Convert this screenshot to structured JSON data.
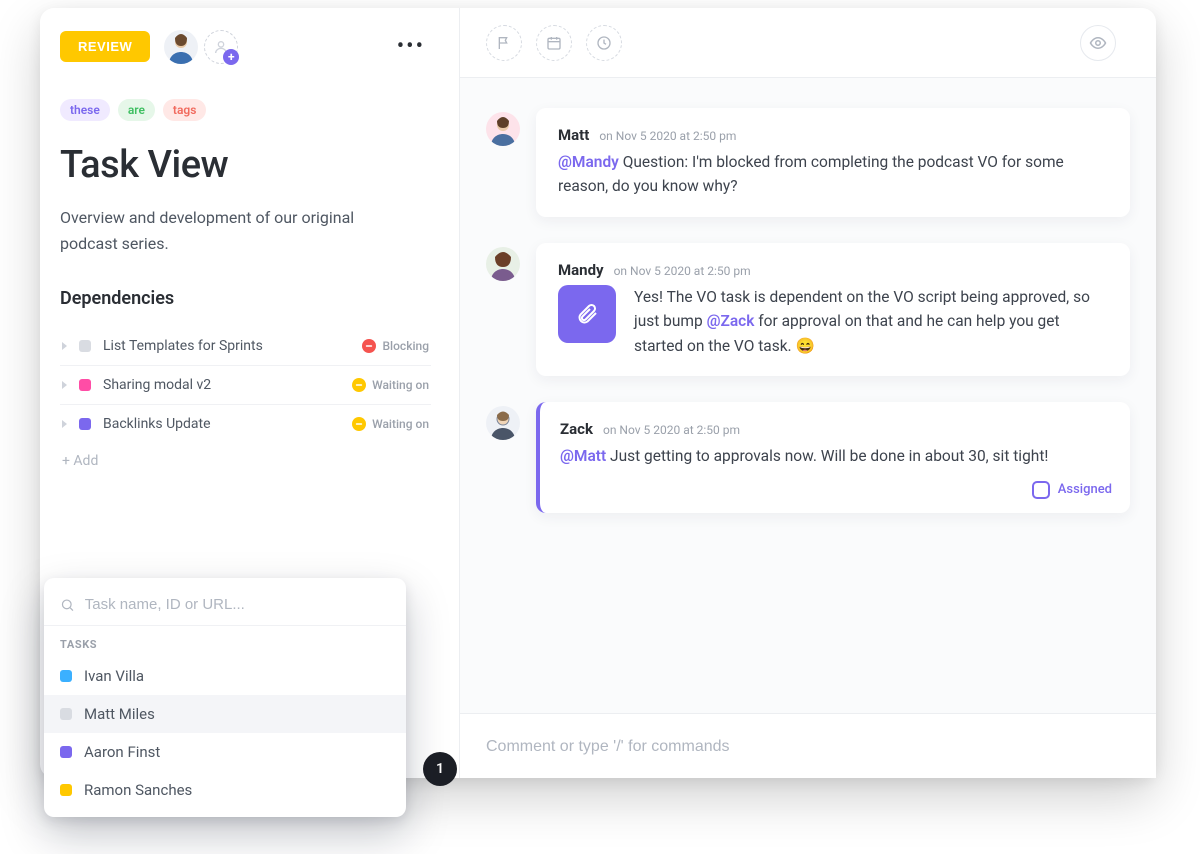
{
  "header": {
    "review_label": "REVIEW"
  },
  "tags": [
    {
      "label": "these",
      "cls": "tag-purple"
    },
    {
      "label": "are",
      "cls": "tag-green"
    },
    {
      "label": "tags",
      "cls": "tag-red"
    }
  ],
  "task": {
    "title": "Task View",
    "description": "Overview and development of our original podcast series."
  },
  "dependencies": {
    "section_title": "Dependencies",
    "add_label": "+ Add",
    "items": [
      {
        "name": "List Templates for Sprints",
        "dot": "dot-gray",
        "status": "Blocking",
        "pill": "pill-red"
      },
      {
        "name": "Sharing modal v2",
        "dot": "dot-pink",
        "status": "Waiting on",
        "pill": "pill-yellow"
      },
      {
        "name": "Backlinks Update",
        "dot": "dot-purple",
        "status": "Waiting on",
        "pill": "pill-yellow"
      }
    ]
  },
  "search_popover": {
    "placeholder": "Task name, ID or URL...",
    "group_label": "TASKS",
    "items": [
      {
        "name": "Ivan Villa",
        "dot": "dot-blue",
        "selected": false
      },
      {
        "name": "Matt Miles",
        "dot": "dot-gray",
        "selected": true
      },
      {
        "name": "Aaron Finst",
        "dot": "dot-purple",
        "selected": false
      },
      {
        "name": "Ramon Sanches",
        "dot": "dot-yellow",
        "selected": false
      }
    ]
  },
  "count_badge": "1",
  "comments": [
    {
      "author": "Matt",
      "timestamp": "on Nov 5 2020 at 2:50 pm",
      "mention": "@Mandy",
      "body_after_mention": " Question: I'm blocked from completing the podcast VO for some reason, do you know why?",
      "avatar_bg": "#fde3ea",
      "accent": false,
      "has_attachment": false
    },
    {
      "author": "Mandy",
      "timestamp": "on Nov 5 2020 at 2:50 pm",
      "body_before_mention": "Yes! The VO task is dependent on the VO script being approved, so just bump ",
      "mention": "@Zack",
      "body_after_mention": " for approval on that and he can help you get started on the VO task. 😄",
      "avatar_bg": "#e8f0e6",
      "accent": false,
      "has_attachment": true
    },
    {
      "author": "Zack",
      "timestamp": "on Nov 5 2020 at 2:50 pm",
      "mention": "@Matt",
      "body_after_mention": " Just getting to approvals now. Will be done in about 30, sit tight!",
      "avatar_bg": "#eef1f6",
      "accent": true,
      "has_attachment": false,
      "assigned_label": "Assigned"
    }
  ],
  "composer": {
    "placeholder": "Comment or type '/' for commands"
  },
  "icons": {
    "person_silhouette": "person-icon",
    "flag": "flag-icon",
    "calendar": "calendar-icon",
    "clock": "clock-icon",
    "eye": "eye-icon",
    "search": "search-icon",
    "attachment": "paperclip-icon"
  }
}
